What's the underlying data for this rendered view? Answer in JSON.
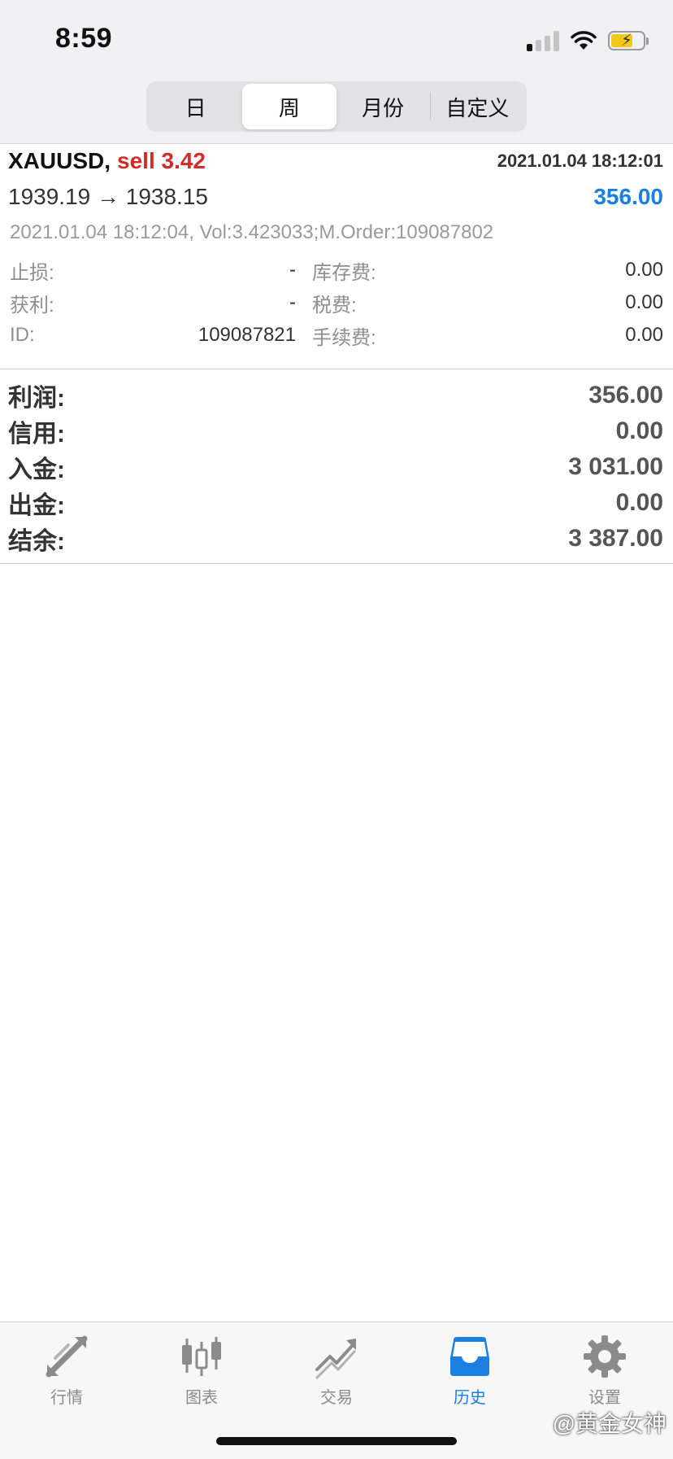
{
  "status_bar": {
    "time": "8:59"
  },
  "period_tabs": [
    {
      "label": "日",
      "active": false
    },
    {
      "label": "周",
      "active": true
    },
    {
      "label": "月份",
      "active": false
    },
    {
      "label": "自定义",
      "active": false
    }
  ],
  "deal": {
    "symbol": "XAUUSD,",
    "side": "sell 3.42",
    "time": "2021.01.04 18:12:01",
    "prices": "1939.19 → 1938.15",
    "profit": "356.00",
    "comment": "2021.01.04 18:12:04, Vol:3.423033;M.Order:109087802",
    "details": [
      {
        "left_label": "止损:",
        "left_value": "-",
        "right_label": "库存费:",
        "right_value": "0.00"
      },
      {
        "left_label": "获利:",
        "left_value": "-",
        "right_label": "税费:",
        "right_value": "0.00"
      },
      {
        "left_label": "ID:",
        "left_value": "109087821",
        "right_label": "手续费:",
        "right_value": "0.00"
      }
    ]
  },
  "summary": [
    {
      "label": "利润:",
      "value": "356.00"
    },
    {
      "label": "信用:",
      "value": "0.00"
    },
    {
      "label": "入金:",
      "value": "3 031.00"
    },
    {
      "label": "出金:",
      "value": "0.00"
    },
    {
      "label": "结余:",
      "value": "3 387.00"
    }
  ],
  "tab_bar": [
    {
      "label": "行情",
      "icon": "quotes-arrows-icon",
      "active": false
    },
    {
      "label": "图表",
      "icon": "candlestick-chart-icon",
      "active": false
    },
    {
      "label": "交易",
      "icon": "trade-trend-icon",
      "active": false
    },
    {
      "label": "历史",
      "icon": "history-inbox-icon",
      "active": true
    },
    {
      "label": "设置",
      "icon": "gear-icon",
      "active": false
    }
  ],
  "watermark": "@黄金女神",
  "colors": {
    "sell": "#d22c25",
    "profit": "#1a7fe0",
    "active_tab": "#1a7fe0",
    "inactive_tab": "#8b8b8b"
  }
}
